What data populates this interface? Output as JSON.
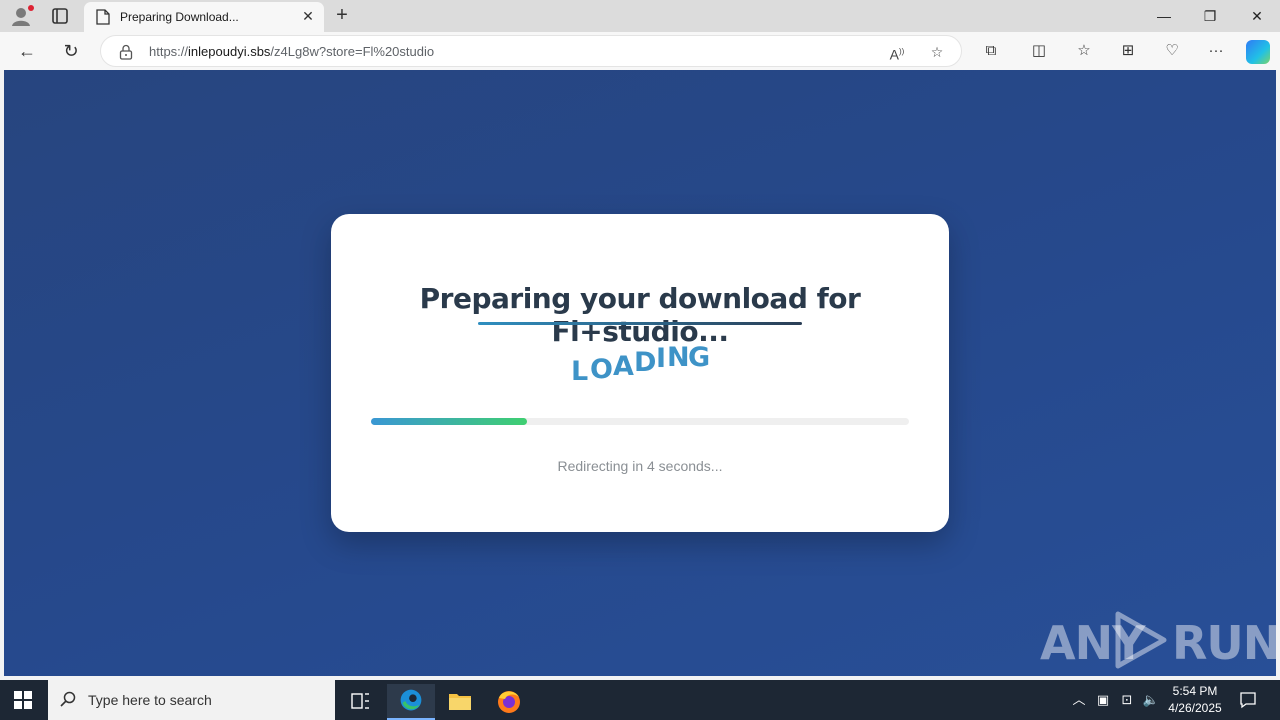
{
  "browser": {
    "tab_title": "Preparing Download...",
    "url_prefix": "https://",
    "url_host": "inlepoudyi.sbs",
    "url_path": "/z4Lg8w?store=Fl%20studio"
  },
  "page": {
    "title": "Preparing your download for Fl+studio...",
    "loading_letters": [
      "L",
      "O",
      "A",
      "D",
      "I",
      "N",
      "G"
    ],
    "progress_percent": 29,
    "redirect_text": "Redirecting in 4 seconds..."
  },
  "watermark": {
    "left": "ANY",
    "right": "RUN"
  },
  "taskbar": {
    "search_placeholder": "Type here to search",
    "time": "5:54 PM",
    "date": "4/26/2025"
  },
  "colors": {
    "accent": "#3e93c7",
    "progress_start": "#3a97d4",
    "progress_end": "#3fcf71",
    "background": "#26498d"
  }
}
